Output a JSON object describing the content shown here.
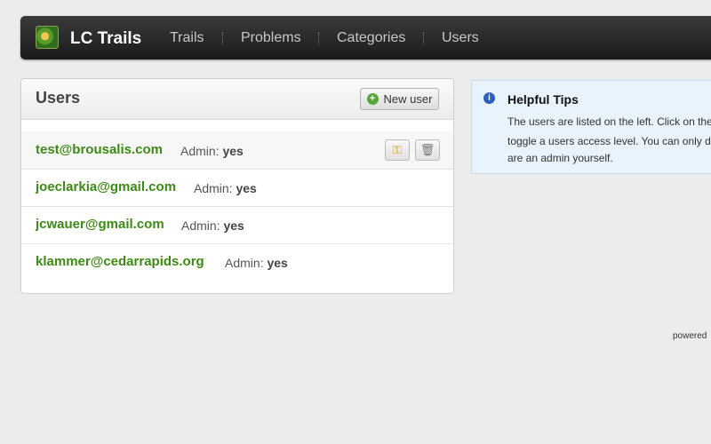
{
  "navbar": {
    "brand": "LC Trails",
    "items": [
      {
        "label": "Trails"
      },
      {
        "label": "Problems"
      },
      {
        "label": "Categories"
      },
      {
        "label": "Users"
      }
    ]
  },
  "panel": {
    "title": "Users",
    "new_user_label": "New user",
    "admin_label": "Admin:",
    "users": [
      {
        "email": "test@brousalis.com",
        "admin": "yes"
      },
      {
        "email": "joeclarkia@gmail.com",
        "admin": "yes"
      },
      {
        "email": "jcwauer@gmail.com",
        "admin": "yes"
      },
      {
        "email": "klammer@cedarrapids.org",
        "admin": "yes"
      }
    ]
  },
  "tips": {
    "title": "Helpful Tips",
    "lines": [
      "The users are listed on the left. Click on the",
      "toggle a users access level. You can only d",
      "are an admin yourself."
    ]
  },
  "footer": {
    "powered": "powered"
  },
  "colors": {
    "email_green": "#3d8a16",
    "navbar_dark": "#1b1b1b",
    "tips_bg": "#e9f3fb"
  }
}
